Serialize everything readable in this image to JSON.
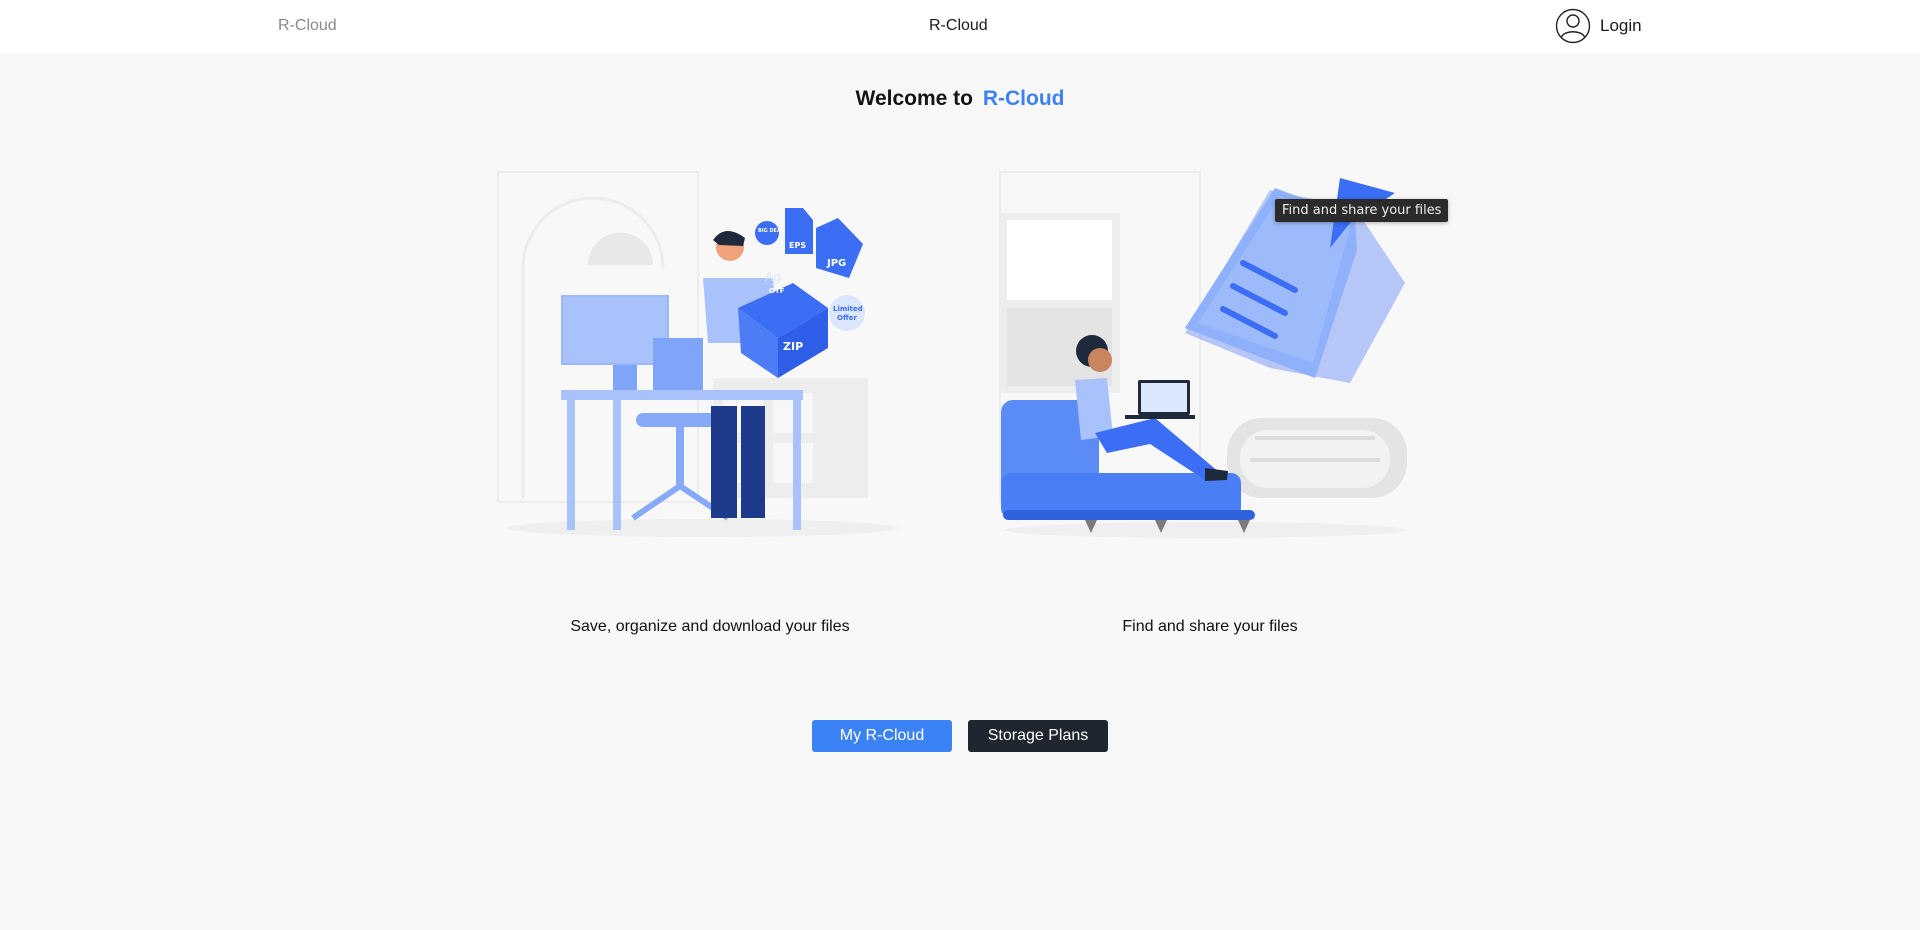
{
  "nav": {
    "brand_left": "R-Cloud",
    "brand_center": "R-Cloud",
    "login_label": "Login",
    "login_icon": "user-circle-icon"
  },
  "hero": {
    "welcome_prefix": "Welcome to",
    "welcome_brand": "R-Cloud"
  },
  "features": [
    {
      "caption": "Save, organize and download your files",
      "illustration": "person-with-file-box-illustration"
    },
    {
      "caption": "Find and share your files",
      "illustration": "person-on-sofa-with-laptop-illustration"
    }
  ],
  "tooltip": {
    "text": "Find and share your files"
  },
  "actions": {
    "primary_label": "My R-Cloud",
    "secondary_label": "Storage Plans"
  },
  "illustration_labels": {
    "big_deal": "BIG DEAL",
    "eps": "EPS",
    "jpg": "JPG",
    "ag": "Ag",
    "otf": "OTF",
    "zip": "ZIP",
    "limited": "Limited",
    "offer": "Offer"
  },
  "colors": {
    "accent": "#3b82f6",
    "dark_button": "#1f2630",
    "background": "#f8f8f8"
  }
}
